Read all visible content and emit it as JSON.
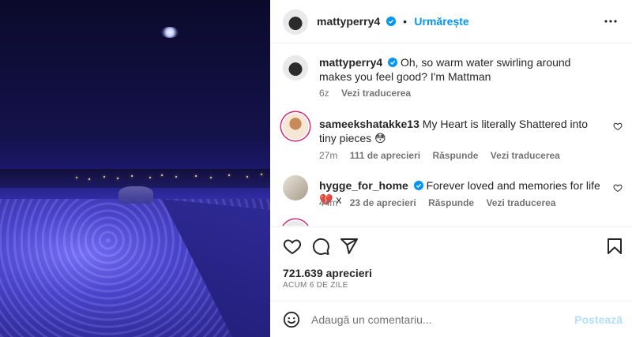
{
  "post": {
    "author": "mattyperry4",
    "follow_label": "Urmărește",
    "dot": "•"
  },
  "caption": {
    "username": "mattyperry4",
    "text": "Oh, so warm water swirling around makes you feel good? I'm Mattman",
    "age": "6z",
    "translate": "Vezi traducerea"
  },
  "comments": [
    {
      "username": "sameekshatakke13",
      "text": "My Heart is literally Shattered into tiny pieces 😳",
      "age": "27m",
      "likes": "111 de aprecieri",
      "reply": "Răspunde",
      "translate": "Vezi traducerea"
    },
    {
      "username": "hygge_for_home",
      "text": "Forever loved and memories for life 💔 x",
      "age": "44m",
      "likes": "23 de aprecieri",
      "reply": "Răspunde",
      "translate": "Vezi traducerea"
    }
  ],
  "stats": {
    "likes": "721.639 aprecieri",
    "time": "ACUM 6 DE ZILE"
  },
  "compose": {
    "placeholder": "Adaugă un comentariu...",
    "post_label": "Postează"
  },
  "colors": {
    "accent": "#0095f6",
    "verified": "#0095f6"
  },
  "icons": [
    "more-icon",
    "verified-icon",
    "heart-icon",
    "comment-icon",
    "share-icon",
    "bookmark-icon",
    "emoji-icon"
  ]
}
